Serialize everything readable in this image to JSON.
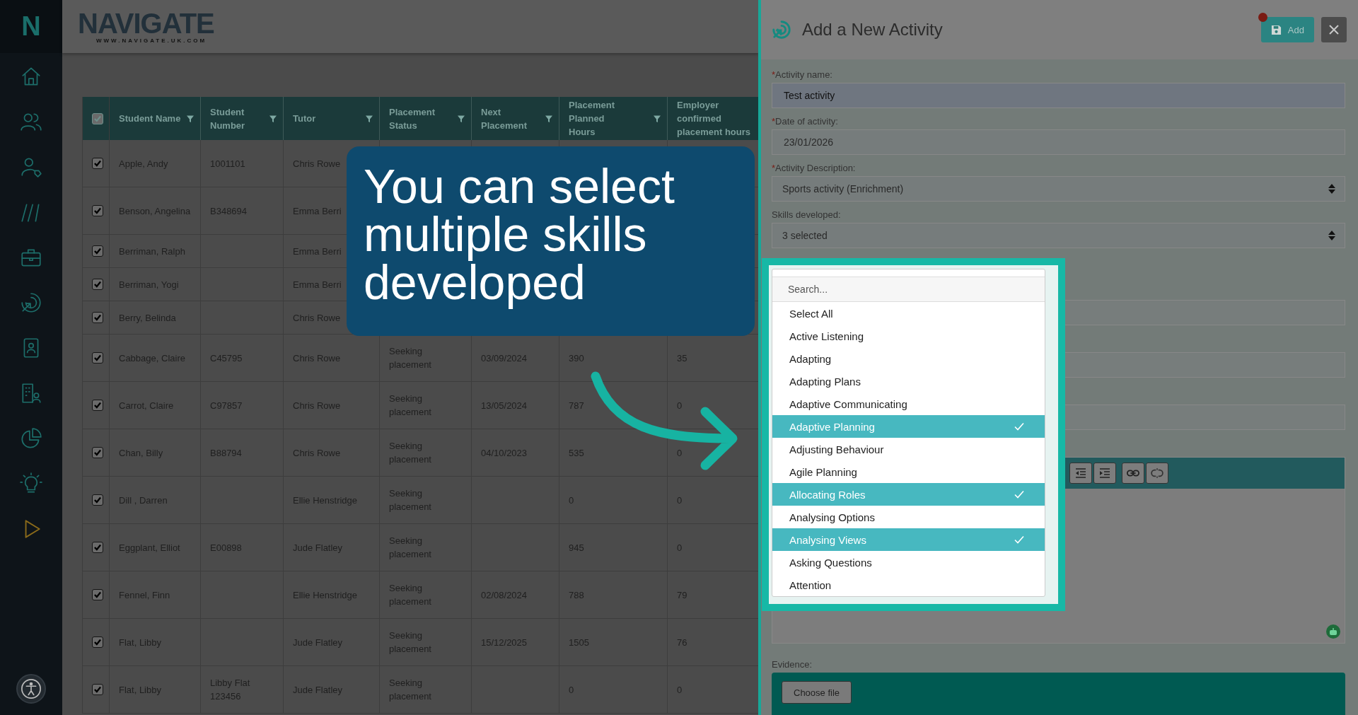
{
  "logo": {
    "mark": "N",
    "name": "NAVIGATE",
    "url": "WWW.NAVIGATE.UK.COM"
  },
  "table": {
    "all_checked": true,
    "columns": [
      "Student Name",
      "Student Number",
      "Tutor",
      "Placement Status",
      "Next Placement",
      "Placement Planned Hours",
      "Employer confirmed placement hours"
    ],
    "rows": [
      {
        "checked": true,
        "cells": [
          "Apple, Andy",
          "1001101",
          "Chris Rowe"
        ]
      },
      {
        "checked": true,
        "cells": [
          "Benson, Angelina",
          "B348694",
          "Emma Berri"
        ]
      },
      {
        "checked": true,
        "cells": [
          "Berriman, Ralph",
          "",
          "Emma Berri"
        ]
      },
      {
        "checked": true,
        "cells": [
          "Berriman, Yogi",
          "",
          "Emma Berri"
        ]
      },
      {
        "checked": true,
        "cells": [
          "Berry, Belinda",
          "",
          "Chris Rowe"
        ]
      },
      {
        "checked": true,
        "cells": [
          "Cabbage, Claire",
          "C45795",
          "Chris Rowe",
          "Seeking placement",
          "03/09/2024",
          "390",
          "35"
        ]
      },
      {
        "checked": true,
        "cells": [
          "Carrot, Claire",
          "C97857",
          "Chris Rowe",
          "Seeking placement",
          "13/05/2024",
          "787",
          "0"
        ]
      },
      {
        "checked": true,
        "cells": [
          "Chan, Billy",
          "B88794",
          "Chris Rowe",
          "Seeking placement",
          "04/10/2023",
          "535",
          "0"
        ]
      },
      {
        "checked": true,
        "cells": [
          "Dill , Darren",
          "",
          "Ellie Henstridge",
          "Seeking placement",
          "",
          "0",
          "0"
        ]
      },
      {
        "checked": true,
        "cells": [
          "Eggplant, Elliot",
          "E00898",
          "Jude Flatley",
          "Seeking placement",
          "",
          "945",
          "0"
        ]
      },
      {
        "checked": true,
        "cells": [
          "Fennel, Finn",
          "",
          "Ellie Henstridge",
          "Seeking placement",
          "02/08/2024",
          "788",
          "79"
        ]
      },
      {
        "checked": true,
        "cells": [
          "Flat, Libby",
          "",
          "Jude Flatley",
          "Seeking placement",
          "15/12/2025",
          "1505",
          "76"
        ]
      },
      {
        "checked": true,
        "cells": [
          "Flat, Libby",
          "Libby Flat 123456",
          "Jude Flatley",
          "Seeking placement",
          "",
          "0",
          "0"
        ]
      }
    ]
  },
  "callout": "You can select multiple skills developed",
  "panel": {
    "title": "Add a New Activity",
    "add_button": "Add",
    "unsaved": true,
    "fields": [
      {
        "kind": "text",
        "label": "Activity name:",
        "required_mark": "*",
        "value": "Test activity"
      },
      {
        "kind": "text",
        "label": "Date of activity:",
        "required_mark": "*",
        "value": "23/01/2026"
      },
      {
        "kind": "select",
        "label": "Activity Description:",
        "required_mark": "*",
        "value": "Sports activity (Enrichment)"
      },
      {
        "kind": "select",
        "label": "Skills developed:",
        "value": "3 selected"
      }
    ],
    "skills_dropdown": {
      "placeholder": "Search...",
      "options": [
        {
          "label": "Select All",
          "selected": false
        },
        {
          "label": "Active Listening",
          "selected": false
        },
        {
          "label": "Adapting",
          "selected": false
        },
        {
          "label": "Adapting Plans",
          "selected": false
        },
        {
          "label": "Adaptive Communicating",
          "selected": false
        },
        {
          "label": "Adaptive Planning",
          "selected": true
        },
        {
          "label": "Adjusting Behaviour",
          "selected": false
        },
        {
          "label": "Agile Planning",
          "selected": false
        },
        {
          "label": "Allocating Roles",
          "selected": true
        },
        {
          "label": "Analysing Options",
          "selected": false
        },
        {
          "label": "Analysing Views",
          "selected": true
        },
        {
          "label": "Asking Questions",
          "selected": false
        },
        {
          "label": "Attention",
          "selected": false
        }
      ]
    },
    "evidence_label": "Evidence:",
    "choose_file": "Choose file"
  }
}
